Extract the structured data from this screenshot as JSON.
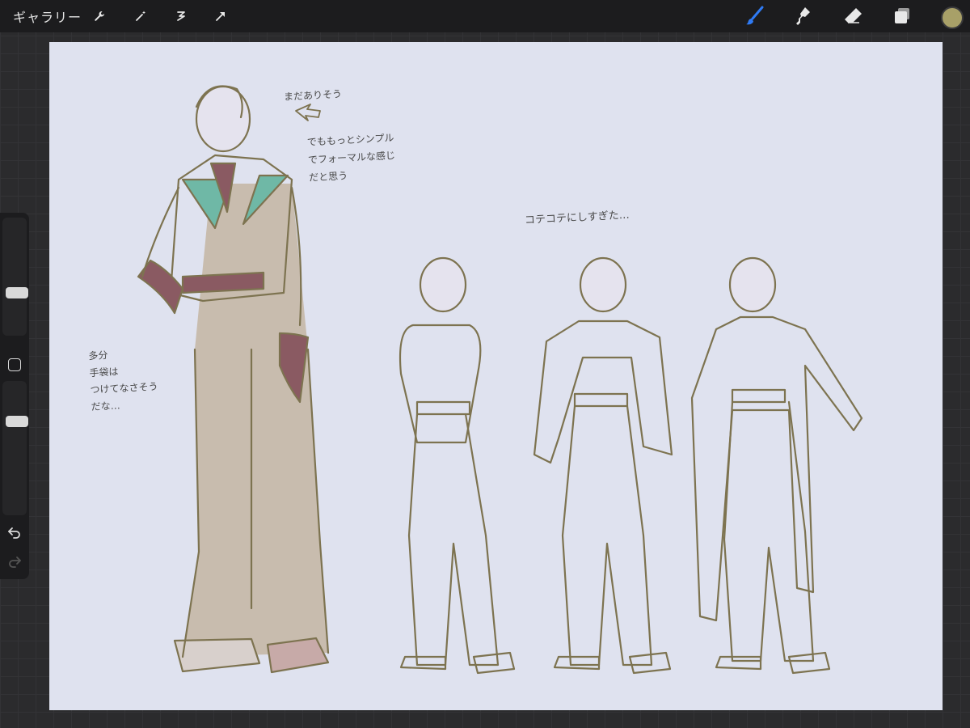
{
  "topbar": {
    "gallery_label": "ギャラリー",
    "left_tools": [
      "wrench-icon",
      "magic-wand-icon",
      "selection-icon",
      "transform-icon"
    ],
    "right_tools": [
      "brush-icon",
      "smudge-icon",
      "eraser-icon",
      "layers-icon"
    ],
    "active_tool": "brush",
    "current_color": "#a8a068"
  },
  "sidebar": {
    "brush_size_level": 0.35,
    "opacity_level": 0.72
  },
  "canvas": {
    "background": "#dfe2ef",
    "notes": {
      "note1": "まだありそう",
      "note2": "でももっとシンプル\nでフォーマルな感じ\nだと思う",
      "note3": "コテコテにしすぎた…",
      "note4": "多分\n手袋は\nつけてなさそう\nだな…"
    }
  }
}
